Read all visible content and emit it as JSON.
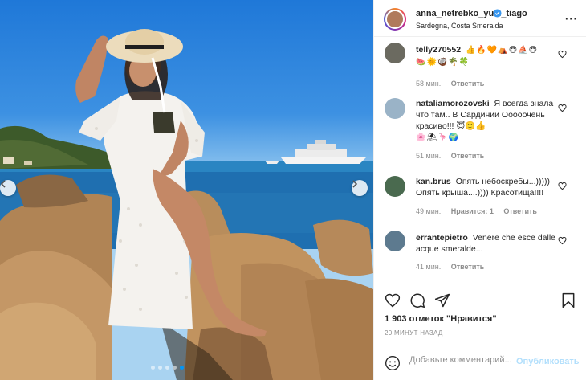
{
  "post": {
    "username": "anna_netrebko_yusi_tiago",
    "location": "Sardegna, Costa Smeralda",
    "likes_text": "1 903 отметок \"Нравится\"",
    "time_text": "20 МИНУТ НАЗАД",
    "carousel_dots": 5
  },
  "comments": [
    {
      "username": "telly270552",
      "text_line1": "👍🔥🧡⛺😍⛵😍",
      "text_line2": "🍉🌞🥥🌴🍀",
      "time": "58 мин.",
      "reply": "Ответить",
      "likes": ""
    },
    {
      "username": "nataliamorozovski",
      "text": "Я всегда знала что там.. В Сардинии Ооооочень красиво!!! 😇🙂👍",
      "text_line2": "🌸⛱🦩🌍",
      "time": "51 мин.",
      "reply": "Ответить",
      "likes": ""
    },
    {
      "username": "kan.brus",
      "text": "Опять небоскребы...))))) Опять крыша....)))) Красотища!!!!",
      "time": "49 мин.",
      "likes": "Нравится: 1",
      "reply": "Ответить"
    },
    {
      "username": "errantepietro",
      "text": "Venere che esce dalle acque smeralde...",
      "time": "41 мин.",
      "reply": "Ответить",
      "likes": ""
    }
  ],
  "add_comment": {
    "placeholder": "Добавьте комментарий...",
    "publish_label": "Опубликовать"
  },
  "colors": {
    "link_blue": "#0095f6",
    "publish_disabled": "#b2dffc",
    "muted": "#8e8e8e"
  },
  "icons": [
    "more-icon",
    "verified-icon",
    "heart-icon",
    "comment-icon",
    "share-icon",
    "bookmark-icon",
    "emoji-icon",
    "chevron-left-icon",
    "chevron-right-icon"
  ]
}
